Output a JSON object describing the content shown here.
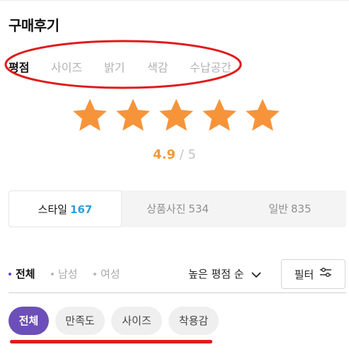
{
  "section_title": "구매후기",
  "review_tabs": [
    {
      "label": "평점",
      "active": true
    },
    {
      "label": "사이즈",
      "active": false
    },
    {
      "label": "밝기",
      "active": false
    },
    {
      "label": "색감",
      "active": false
    },
    {
      "label": "수납공간",
      "active": false
    }
  ],
  "rating": {
    "stars": 5,
    "score": "4.9",
    "separator": "/",
    "max": "5",
    "star_color": "#f7943a"
  },
  "segments": [
    {
      "label": "스타일",
      "count": "167",
      "active": true
    },
    {
      "label": "상품사진",
      "count": "534",
      "active": false
    },
    {
      "label": "일반",
      "count": "835",
      "active": false
    }
  ],
  "gender_filters": [
    {
      "label": "전체",
      "active": true
    },
    {
      "label": "남성",
      "active": false
    },
    {
      "label": "여성",
      "active": false
    }
  ],
  "sort": {
    "label": "높은 평점 순",
    "icon": "chevron-down-icon"
  },
  "filter_button": {
    "label": "필터",
    "icon": "sliders-icon"
  },
  "chips": [
    {
      "label": "전체",
      "active": true
    },
    {
      "label": "만족도",
      "active": false
    },
    {
      "label": "사이즈",
      "active": false
    },
    {
      "label": "착용감",
      "active": false
    }
  ],
  "colors": {
    "accent_purple": "#6c4fb8",
    "count_blue": "#2f9fd8",
    "score_orange": "#f0993e",
    "annotation_red": "#e01b1b"
  }
}
